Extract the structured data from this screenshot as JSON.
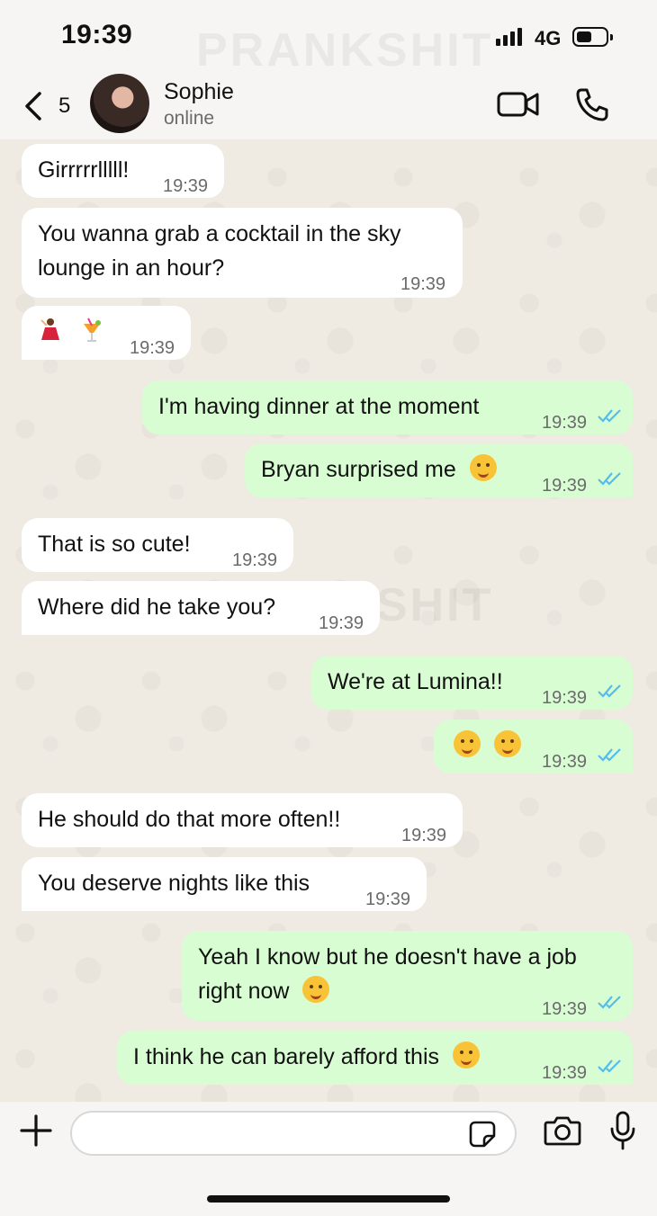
{
  "status_bar": {
    "time": "19:39",
    "network": "4G"
  },
  "watermark": "PRANKSHIT",
  "header": {
    "back_count": "5",
    "contact_name": "Sophie",
    "contact_status": "online"
  },
  "messages": [
    {
      "direction": "in",
      "text": "Girrrrrlllll!",
      "time": "19:39"
    },
    {
      "direction": "in",
      "text_lines": [
        "You wanna grab a cocktail in the sky",
        "lounge in an hour?"
      ],
      "time": "19:39"
    },
    {
      "direction": "in",
      "emojis": [
        "dancer-emoji",
        "tropical-drink-emoji"
      ],
      "time": "19:39"
    },
    {
      "direction": "out",
      "text": "I'm having dinner at the moment",
      "time": "19:39",
      "status": "read"
    },
    {
      "direction": "out",
      "text": "Bryan surprised me",
      "emoji": "face-with-hand-over-mouth-emoji",
      "time": "19:39",
      "status": "read"
    },
    {
      "direction": "in",
      "text": "That is so cute!",
      "time": "19:39"
    },
    {
      "direction": "in",
      "text": "Where did he take you?",
      "time": "19:39"
    },
    {
      "direction": "out",
      "text": "We're at Lumina!!",
      "time": "19:39",
      "status": "read"
    },
    {
      "direction": "out",
      "emojis": [
        "smiling-face-with-hearts-emoji",
        "yum-emoji"
      ],
      "time": "19:39",
      "status": "read"
    },
    {
      "direction": "in",
      "text": "He should do that more often!!",
      "time": "19:39"
    },
    {
      "direction": "in",
      "text": "You deserve nights like this",
      "time": "19:39"
    },
    {
      "direction": "out",
      "text_lines": [
        "Yeah I know but he doesn't have a job",
        "right now"
      ],
      "emoji": "grinning-sweat-emoji",
      "time": "19:39",
      "status": "read"
    },
    {
      "direction": "out",
      "text": "I think he can barely afford this",
      "emoji": "holding-back-tears-emoji",
      "time": "19:39",
      "status": "read"
    }
  ],
  "input": {
    "placeholder": ""
  },
  "colors": {
    "outgoing_bubble": "#d9fdd3",
    "incoming_bubble": "#ffffff",
    "read_ticks": "#53bdeb",
    "chat_background": "#efeae2"
  }
}
